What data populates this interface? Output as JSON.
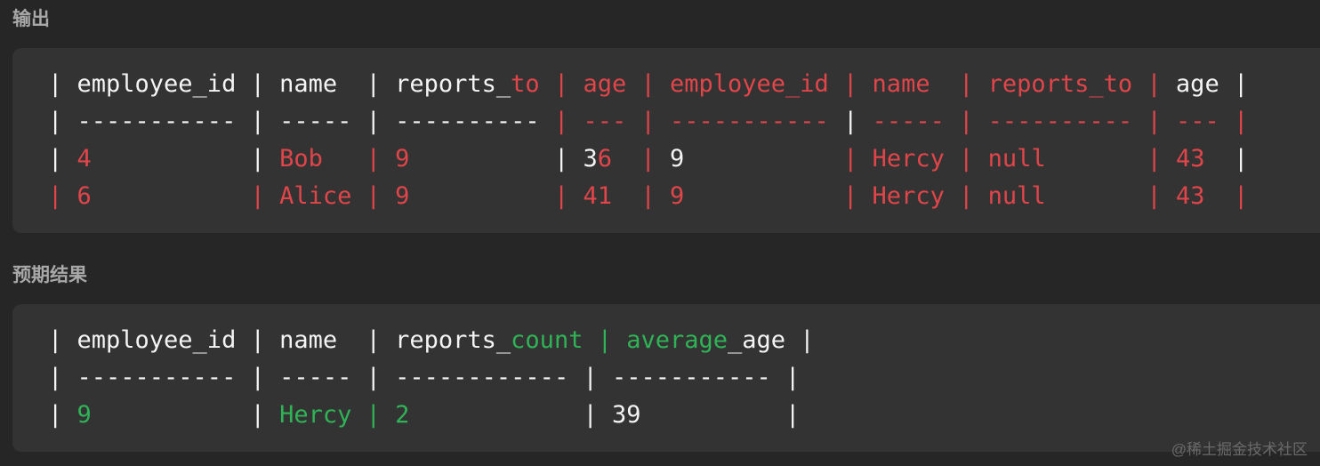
{
  "output": {
    "title": "输出",
    "lines": [
      [
        {
          "t": "| employee_id | name  | reports_",
          "c": "w"
        },
        {
          "t": "to | age | employee_id | name  | reports_to |",
          "c": "r"
        },
        {
          "t": " age |",
          "c": "w"
        }
      ],
      [
        {
          "t": "| ----------- | ----- | ---------- ",
          "c": "w"
        },
        {
          "t": "| --- | ",
          "c": "r"
        },
        {
          "t": "----------- ",
          "c": "r"
        },
        {
          "t": "| ",
          "c": "w"
        },
        {
          "t": "----- | ---------- | --- |",
          "c": "r"
        }
      ],
      [
        {
          "t": "| ",
          "c": "w"
        },
        {
          "t": "4",
          "c": "r"
        },
        {
          "t": "           | ",
          "c": "w"
        },
        {
          "t": "Bob   | 9",
          "c": "r"
        },
        {
          "t": "          | 3",
          "c": "w"
        },
        {
          "t": "6",
          "c": "r"
        },
        {
          "t": "  ",
          "c": "w"
        },
        {
          "t": "|",
          "c": "r"
        },
        {
          "t": " 9           ",
          "c": "w"
        },
        {
          "t": "| Hercy | null       | 43",
          "c": "r"
        },
        {
          "t": "  |",
          "c": "w"
        }
      ],
      [
        {
          "t": "| 6           | Alice | 9          | 41  | 9           | Hercy | null       | 43  |",
          "c": "r"
        }
      ]
    ]
  },
  "expected": {
    "title": "预期结果",
    "lines": [
      [
        {
          "t": "| employee_id | name  | reports_",
          "c": "w"
        },
        {
          "t": "count | average",
          "c": "g"
        },
        {
          "t": "_age |",
          "c": "w"
        }
      ],
      [
        {
          "t": "| ----------- | ----- | ------------ | ----------- |",
          "c": "w"
        }
      ],
      [
        {
          "t": "| ",
          "c": "w"
        },
        {
          "t": "9",
          "c": "g"
        },
        {
          "t": "           | ",
          "c": "w"
        },
        {
          "t": "Hercy | 2",
          "c": "g"
        },
        {
          "t": "            | 39          |",
          "c": "w"
        }
      ]
    ]
  },
  "colors": {
    "w": "#f4f4f4",
    "r": "#e0454a",
    "g": "#2fb356"
  },
  "watermark": "@稀土掘金技术社区"
}
